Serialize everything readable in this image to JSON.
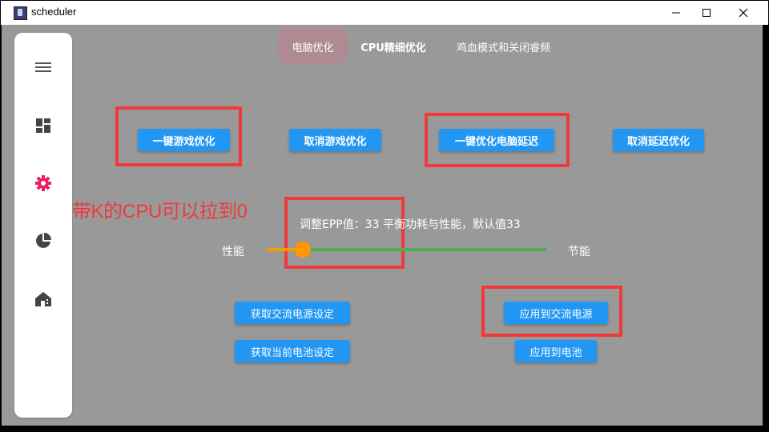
{
  "window": {
    "title": "scheduler"
  },
  "sidebar": {
    "items": [
      {
        "id": "menu",
        "icon": "hamburger-menu-icon"
      },
      {
        "id": "dashboard",
        "icon": "dashboard-icon"
      },
      {
        "id": "settings",
        "icon": "gear-icon",
        "active": true
      },
      {
        "id": "chart",
        "icon": "pie-chart-icon"
      },
      {
        "id": "home",
        "icon": "home-icon"
      }
    ]
  },
  "tabs": [
    {
      "label": "电脑优化",
      "active": true
    },
    {
      "label": "CPU精细优化"
    },
    {
      "label": "鸡血模式和关闭睿频"
    }
  ],
  "actions": {
    "game_optimize": "一键游戏优化",
    "cancel_game_optimize": "取消游戏优化",
    "optimize_latency": "一键优化电脑延迟",
    "cancel_latency": "取消延迟优化"
  },
  "annotation": {
    "text": "带K的CPU可以拉到0"
  },
  "epp": {
    "label": "调整EPP值：33 平衡功耗与性能，默认值33",
    "value": 33,
    "min": 0,
    "max": 255,
    "left_label": "性能",
    "right_label": "节能"
  },
  "power": {
    "get_ac": "获取交流电源设定",
    "get_battery": "获取当前电池设定",
    "apply_ac": "应用到交流电源",
    "apply_battery": "应用到电池"
  },
  "colors": {
    "accent": "#2196f3",
    "slider_active": "#ff9800",
    "slider_inactive": "#4caf50",
    "highlight": "#f03a3a",
    "nav_active": "#e91e63",
    "background": "#999999"
  }
}
